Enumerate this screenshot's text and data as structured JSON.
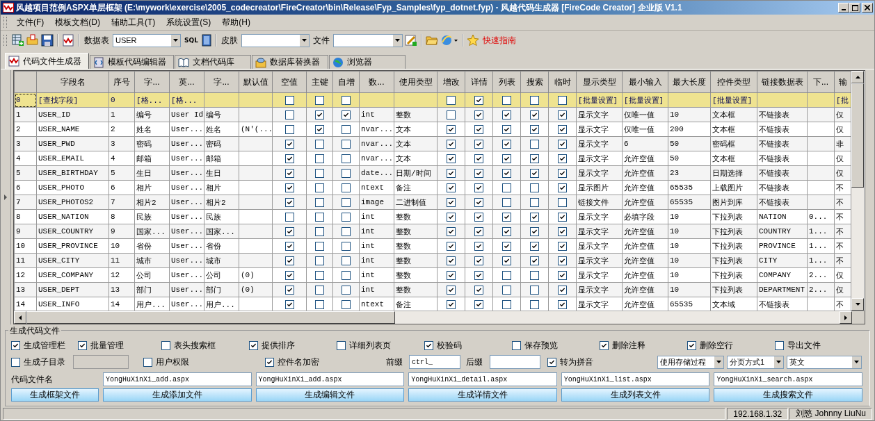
{
  "window": {
    "title": "风越项目范例ASPX单层框架 (E:\\mywork\\exercise\\2005_codecreator\\FireCreator\\bin\\Release\\Fyp_Samples\\fyp_dotnet.fyp) - 风越代码生成器 [FireCode Creator] 企业版 V1.1"
  },
  "menu": [
    "文件(F)",
    "模板文档(D)",
    "辅助工具(T)",
    "系统设置(S)",
    "帮助(H)"
  ],
  "toolbar": {
    "table_label": "数据表",
    "table_value": "USER",
    "sql_label": "SQL",
    "skin_label": "皮肤",
    "file_label": "文件",
    "guide": "快速指南"
  },
  "tabs": [
    {
      "label": "代码文件生成器",
      "selected": true
    },
    {
      "label": "模板代码编辑器",
      "selected": false
    },
    {
      "label": "文档代码库",
      "selected": false
    },
    {
      "label": "数据库替换器",
      "selected": false
    },
    {
      "label": "浏览器",
      "selected": false
    }
  ],
  "table": {
    "columns": [
      {
        "label": "字段名",
        "kind": "text"
      },
      {
        "label": "序号",
        "kind": "text"
      },
      {
        "label": "字...",
        "kind": "text"
      },
      {
        "label": "英...",
        "kind": "text"
      },
      {
        "label": "字...",
        "kind": "text"
      },
      {
        "label": "默认值",
        "kind": "text"
      },
      {
        "label": "空值",
        "kind": "check"
      },
      {
        "label": "主键",
        "kind": "check"
      },
      {
        "label": "自增",
        "kind": "check"
      },
      {
        "label": "数...",
        "kind": "text"
      },
      {
        "label": "使用类型",
        "kind": "text"
      },
      {
        "label": "增改",
        "kind": "check"
      },
      {
        "label": "详情",
        "kind": "check"
      },
      {
        "label": "列表",
        "kind": "check"
      },
      {
        "label": "搜索",
        "kind": "check"
      },
      {
        "label": "临时",
        "kind": "check"
      },
      {
        "label": "显示类型",
        "kind": "text"
      },
      {
        "label": "最小输入",
        "kind": "text"
      },
      {
        "label": "最大长度",
        "kind": "text"
      },
      {
        "label": "控件类型",
        "kind": "text"
      },
      {
        "label": "链接数据表",
        "kind": "text"
      },
      {
        "label": "下...",
        "kind": "text"
      },
      {
        "label": "输",
        "kind": "text"
      }
    ],
    "rows": [
      {
        "index": "0",
        "kind": "filter",
        "cells": [
          "[查找字段]",
          "0",
          "[格...",
          "[格...",
          "",
          "",
          false,
          false,
          false,
          "",
          "",
          false,
          true,
          false,
          false,
          false,
          "[批量设置]",
          "[批量设置]",
          "",
          "[批量设置]",
          "",
          "",
          "[批"
        ]
      },
      {
        "index": "1",
        "kind": "data",
        "cells": [
          "USER_ID",
          "1",
          "编号",
          "User Id",
          "编号",
          "",
          false,
          true,
          true,
          "int",
          "整数",
          false,
          true,
          true,
          true,
          true,
          "显示文字",
          "仅唯一值",
          "10",
          "文本框",
          "不链接表",
          "",
          "仅"
        ]
      },
      {
        "index": "2",
        "kind": "data",
        "cells": [
          "USER_NAME",
          "2",
          "姓名",
          "User...",
          "姓名",
          "(N'(...",
          false,
          true,
          false,
          "nvar...",
          "文本",
          true,
          true,
          true,
          true,
          true,
          "显示文字",
          "仅唯一值",
          "200",
          "文本框",
          "不链接表",
          "",
          "仅"
        ]
      },
      {
        "index": "3",
        "kind": "data",
        "cells": [
          "USER_PWD",
          "3",
          "密码",
          "User...",
          "密码",
          "",
          true,
          false,
          false,
          "nvar...",
          "文本",
          true,
          true,
          true,
          false,
          true,
          "显示文字",
          "6",
          "50",
          "密码框",
          "不链接表",
          "",
          "非"
        ]
      },
      {
        "index": "4",
        "kind": "data",
        "cells": [
          "USER_EMAIL",
          "4",
          "邮箱",
          "User...",
          "邮箱",
          "",
          true,
          false,
          false,
          "nvar...",
          "文本",
          true,
          true,
          true,
          true,
          true,
          "显示文字",
          "允许空值",
          "50",
          "文本框",
          "不链接表",
          "",
          "仅"
        ]
      },
      {
        "index": "5",
        "kind": "data",
        "cells": [
          "USER_BIRTHDAY",
          "5",
          "生日",
          "User...",
          "生日",
          "",
          true,
          false,
          false,
          "date...",
          "日期/时间",
          true,
          true,
          true,
          true,
          true,
          "显示文字",
          "允许空值",
          "23",
          "日期选择",
          "不链接表",
          "",
          "仅"
        ]
      },
      {
        "index": "6",
        "kind": "data",
        "cells": [
          "USER_PHOTO",
          "6",
          "相片",
          "User...",
          "相片",
          "",
          true,
          false,
          false,
          "ntext",
          "备注",
          true,
          true,
          false,
          false,
          true,
          "显示图片",
          "允许空值",
          "65535",
          "上载图片",
          "不链接表",
          "",
          "不"
        ]
      },
      {
        "index": "7",
        "kind": "data",
        "cells": [
          "USER_PHOTOS2",
          "7",
          "相片2",
          "User...",
          "相片2",
          "",
          true,
          false,
          false,
          "image",
          "二进制值",
          true,
          true,
          false,
          false,
          false,
          "链接文件",
          "允许空值",
          "65535",
          "图片到库",
          "不链接表",
          "",
          "不"
        ]
      },
      {
        "index": "8",
        "kind": "data",
        "cells": [
          "USER_NATION",
          "8",
          "民族",
          "User...",
          "民族",
          "",
          false,
          false,
          false,
          "int",
          "整数",
          true,
          true,
          true,
          true,
          true,
          "显示文字",
          "必填字段",
          "10",
          "下拉列表",
          "NATION",
          "0...",
          "不"
        ]
      },
      {
        "index": "9",
        "kind": "data",
        "cells": [
          "USER_COUNTRY",
          "9",
          "国家...",
          "User...",
          "国家...",
          "",
          true,
          false,
          false,
          "int",
          "整数",
          true,
          true,
          true,
          true,
          true,
          "显示文字",
          "允许空值",
          "10",
          "下拉列表",
          "COUNTRY",
          "1...",
          "不"
        ]
      },
      {
        "index": "10",
        "kind": "data",
        "cells": [
          "USER_PROVINCE",
          "10",
          "省份",
          "User...",
          "省份",
          "",
          true,
          false,
          false,
          "int",
          "整数",
          true,
          true,
          true,
          true,
          true,
          "显示文字",
          "允许空值",
          "10",
          "下拉列表",
          "PROVINCE",
          "1...",
          "不"
        ]
      },
      {
        "index": "11",
        "kind": "data",
        "cells": [
          "USER_CITY",
          "11",
          "城市",
          "User...",
          "城市",
          "",
          true,
          false,
          false,
          "int",
          "整数",
          true,
          true,
          true,
          true,
          true,
          "显示文字",
          "允许空值",
          "10",
          "下拉列表",
          "CITY",
          "1...",
          "不"
        ]
      },
      {
        "index": "12",
        "kind": "data",
        "cells": [
          "USER_COMPANY",
          "12",
          "公司",
          "User...",
          "公司",
          "(0)",
          true,
          false,
          false,
          "int",
          "整数",
          true,
          true,
          false,
          false,
          true,
          "显示文字",
          "允许空值",
          "10",
          "下拉列表",
          "COMPANY",
          "2...",
          "仅"
        ]
      },
      {
        "index": "13",
        "kind": "data",
        "cells": [
          "USER_DEPT",
          "13",
          "部门",
          "User...",
          "部门",
          "(0)",
          true,
          false,
          false,
          "int",
          "整数",
          true,
          true,
          false,
          false,
          true,
          "显示文字",
          "允许空值",
          "10",
          "下拉列表",
          "DEPARTMENT",
          "2...",
          "仅"
        ]
      },
      {
        "index": "14",
        "kind": "data",
        "cells": [
          "USER_INFO",
          "14",
          "用户...",
          "User...",
          "用户...",
          "",
          true,
          false,
          false,
          "ntext",
          "备注",
          true,
          true,
          false,
          false,
          true,
          "显示文字",
          "允许空值",
          "65535",
          "文本域",
          "不链接表",
          "",
          "不"
        ]
      }
    ]
  },
  "options": {
    "title": "生成代码文件",
    "checks": [
      {
        "label": "生成管理栏",
        "checked": true
      },
      {
        "label": "批量管理",
        "checked": true
      },
      {
        "label": "表头搜索框",
        "checked": false
      },
      {
        "label": "提供排序",
        "checked": true
      },
      {
        "label": "详细列表页",
        "checked": false
      },
      {
        "label": "校验码",
        "checked": true
      },
      {
        "label": "保存预览",
        "checked": false
      },
      {
        "label": "删除注释",
        "checked": true
      },
      {
        "label": "删除空行",
        "checked": true
      },
      {
        "label": "导出文件",
        "checked": false
      }
    ],
    "subdir": {
      "label": "生成子目录",
      "checked": false
    },
    "subdir_path": {
      "disabled": true
    },
    "user_rights": {
      "label": "用户权限",
      "checked": false
    },
    "encrypt": {
      "label": "控件名加密",
      "checked": true
    },
    "prefix": {
      "label": "前缀",
      "value": "ctrl_"
    },
    "suffix": {
      "label": "后缀"
    },
    "pinyin": {
      "label": "转为拼音",
      "checked": true
    },
    "selects": [
      "使用存储过程",
      "分页方式1",
      "英文"
    ],
    "filename_label": "代码文件名",
    "filenames": [
      "YongHuXinXi_add.aspx",
      "YongHuXinXi_add.aspx",
      "YongHuXinXi_detail.aspx",
      "YongHuXinXi_list.aspx",
      "YongHuXinXi_search.aspx"
    ],
    "buttons": [
      "生成框架文件",
      "生成添加文件",
      "生成编辑文件",
      "生成详情文件",
      "生成列表文件",
      "生成搜索文件"
    ]
  },
  "status_bar": {
    "panels": [
      "192.168.1.32",
      "刘愍 Johnny LiuNu"
    ]
  }
}
